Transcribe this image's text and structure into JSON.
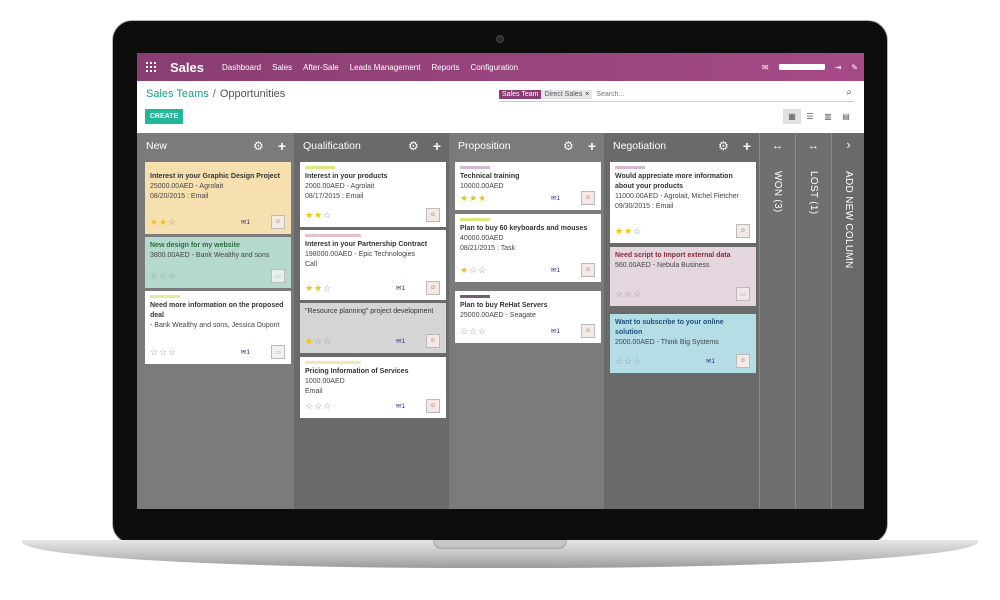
{
  "app": {
    "brand": "Sales",
    "menu": [
      "Dashboard",
      "Sales",
      "After-Sale",
      "Leads Management",
      "Reports",
      "Configuration"
    ],
    "icons": {
      "apps": "apps-grid-icon",
      "mail": "envelope-icon",
      "logout": "sign-out-icon",
      "chat": "chat-icon"
    }
  },
  "breadcrumb": {
    "parent": "Sales Teams",
    "separator": "/",
    "current": "Opportunities"
  },
  "search": {
    "facet_label": "Sales Team",
    "facet_value": "Direct Sales",
    "facet_remove": "×",
    "placeholder": "Search..."
  },
  "create_label": "CREATE",
  "colors": {
    "brand": "#8a3d73",
    "create": "#21b799",
    "link": "#1a9e8c"
  },
  "columns": [
    {
      "title": "New",
      "cards": [
        {
          "title": "Interest in your Graphic Design Project",
          "lines": [
            "25000.00AED - Agrolait",
            "08/20/2015 : Email"
          ],
          "stars": 2,
          "msg": "1",
          "bg": "#f6e0b0",
          "tag": "#f2dfa6",
          "avatar": true
        },
        {
          "title": "New design for my website",
          "lines": [
            "3800.00AED - Bank Wealthy and sons"
          ],
          "stars": 0,
          "msg": "",
          "bg": "#b5d9cf",
          "tag": "",
          "avatar": false,
          "title_color": "#2a6f3a"
        },
        {
          "title": "Need more information on the proposed deal",
          "lines": [
            "- Bank Wealthy and sons, Jessica Dupont"
          ],
          "stars": 0,
          "msg": "1",
          "bg": "#ffffff",
          "tag": "#e8e89a",
          "avatar": false
        }
      ]
    },
    {
      "title": "Qualification",
      "cards": [
        {
          "title": "Interest in your products",
          "lines": [
            "2000.00AED - Agrolait",
            "08/17/2015 : Email"
          ],
          "stars": 2,
          "msg": "",
          "bg": "#ffffff",
          "tag": "#dde77a",
          "avatar": true
        },
        {
          "title": "Interest in your Partnership Contract",
          "lines": [
            "198000.00AED - Epic Technologies",
            "Call"
          ],
          "stars": 2,
          "msg": "1",
          "bg": "#ffffff",
          "tag": "#e7c3c8",
          "avatar": true
        },
        {
          "title": "\"Resource planning\" project development",
          "lines": [],
          "stars": 1,
          "msg": "1",
          "bg": "#d5d5d5",
          "tag": "",
          "avatar": true
        },
        {
          "title": "Pricing Information of Services",
          "lines": [
            "1000.00AED",
            "Email"
          ],
          "stars": 0,
          "msg": "1",
          "bg": "#ffffff",
          "tag": "#f2e6bd",
          "avatar": true
        }
      ]
    },
    {
      "title": "Proposition",
      "cards": [
        {
          "title": "Technical training",
          "lines": [
            "10000.00AED"
          ],
          "stars": 3,
          "msg": "1",
          "bg": "#ffffff",
          "tag": "#d6b7d6",
          "avatar": true
        },
        {
          "title": "Plan to buy 60 keyboards and mouses",
          "lines": [
            "40000.00AED",
            "08/21/2015 : Task"
          ],
          "stars": 1,
          "msg": "1",
          "bg": "#ffffff",
          "tag": "#dde77a",
          "avatar": true
        },
        {
          "title": "Plan to buy ReHat Servers",
          "lines": [
            "25000.00AED - Seagate"
          ],
          "stars": 0,
          "msg": "1",
          "bg": "#ffffff",
          "tag": "#7a5a7a",
          "avatar": true
        }
      ]
    },
    {
      "title": "Negotiation",
      "cards": [
        {
          "title": "Would appreciate more information about your products",
          "lines": [
            "11000.00AED - Agrolait, Michel Fletcher",
            "09/30/2015 : Email"
          ],
          "stars": 2,
          "msg": "",
          "bg": "#ffffff",
          "tag": "#d6b7d6",
          "avatar": true
        },
        {
          "title": "Need script to Import external data",
          "lines": [
            "560.00AED - Nebula Business"
          ],
          "stars": 0,
          "msg": "",
          "bg": "#e4d6de",
          "tag": "",
          "avatar": false,
          "title_color": "#8a2a3a"
        },
        {
          "title": "Want to subscribe to your online solution",
          "lines": [
            "2000.00AED - Think Big Systems"
          ],
          "stars": 0,
          "msg": "1",
          "bg": "#b5dde6",
          "tag": "",
          "avatar": true,
          "title_color": "#1e4f7a"
        }
      ]
    }
  ],
  "folded": [
    {
      "label": "WON (3)",
      "icon": "expand-arrows-icon"
    },
    {
      "label": "LOST (1)",
      "icon": "expand-arrows-icon"
    },
    {
      "label": "ADD NEW COLUMN",
      "icon": "chevron-right-icon"
    }
  ]
}
